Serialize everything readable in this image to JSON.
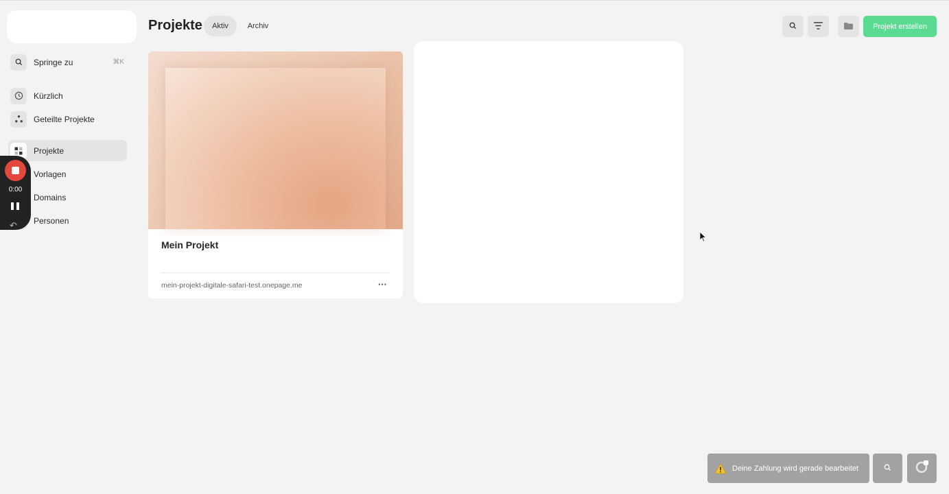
{
  "sidebar": {
    "jump": {
      "label": "Springe zu",
      "shortcut": "⌘K",
      "icon": "search-icon"
    },
    "items": [
      {
        "label": "Kürzlich",
        "icon": "clock-icon"
      },
      {
        "label": "Geteilte Projekte",
        "icon": "share-icon"
      },
      {
        "label": "Projekte",
        "icon": "grid-icon",
        "active": true
      },
      {
        "label": "Vorlagen",
        "icon": "template-icon"
      },
      {
        "label": "Domains",
        "icon": "globe-icon"
      },
      {
        "label": "Personen",
        "icon": "people-icon"
      }
    ]
  },
  "recorder": {
    "time": "0:00"
  },
  "header": {
    "title": "Projekte",
    "tabs": [
      {
        "label": "Aktiv",
        "active": true
      },
      {
        "label": "Archiv",
        "active": false
      }
    ],
    "create_button": "Projekt erstellen"
  },
  "projects": [
    {
      "title": "Mein Projekt",
      "url": "mein-projekt-digitale-safari-test.onepage.me",
      "more": "···"
    }
  ],
  "footer": {
    "toast": "Deine Zahlung wird gerade bearbeitet"
  },
  "colors": {
    "accent": "#5bdb91",
    "recorder_stop": "#e4473d",
    "background": "#f3f3f3"
  }
}
